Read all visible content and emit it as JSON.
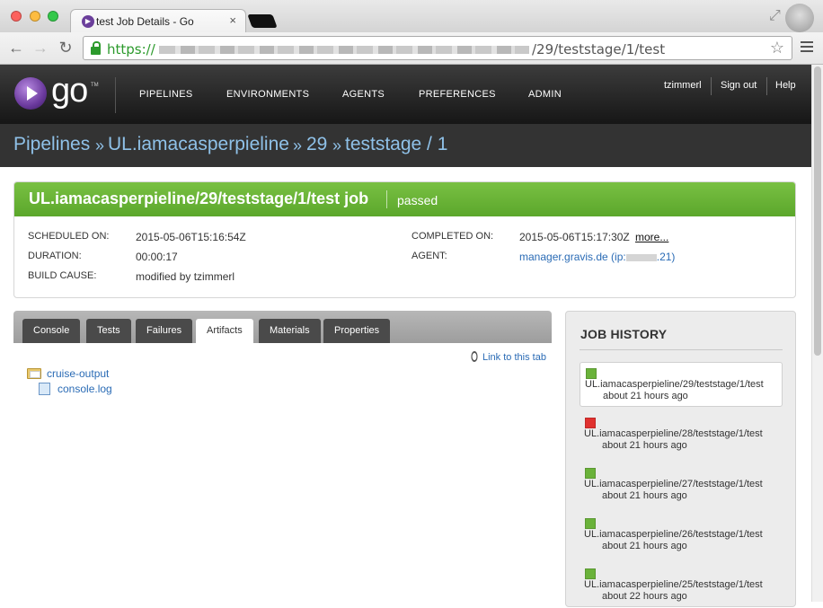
{
  "browser": {
    "tab_title": "test Job Details - Go",
    "tab_close": "×",
    "url_scheme": "https://",
    "url_path": "/29/teststage/1/test",
    "star": "☆",
    "nav_back": "←",
    "nav_forward": "→",
    "nav_reload": "↻",
    "fullscreen": "⤢"
  },
  "header": {
    "logo_text": "go",
    "logo_tm": "TM",
    "nav": [
      "PIPELINES",
      "ENVIRONMENTS",
      "AGENTS",
      "PREFERENCES",
      "ADMIN"
    ],
    "user": "tzimmerl",
    "sign_out": "Sign out",
    "help": "Help"
  },
  "breadcrumb": {
    "pipelines": "Pipelines",
    "sep": "»",
    "pipeline": "UL.iamacasperpieline",
    "counter": "29",
    "stage": "teststage / 1"
  },
  "job": {
    "title": "UL.iamacasperpieline/29/teststage/1/test job",
    "status": "passed",
    "status_color": "#6ab23a",
    "scheduled_label": "SCHEDULED ON:",
    "scheduled_value": "2015-05-06T15:16:54Z",
    "duration_label": "DURATION:",
    "duration_value": "00:00:17",
    "cause_label": "BUILD CAUSE:",
    "cause_value": "modified by tzimmerl",
    "completed_label": "COMPLETED ON:",
    "completed_value": "2015-05-06T15:17:30Z",
    "more": "more...",
    "agent_label": "AGENT:",
    "agent_prefix": "manager.gravis.de (ip:",
    "agent_suffix": ".21)"
  },
  "tabs": [
    "Console",
    "Tests",
    "Failures",
    "Artifacts",
    "Materials",
    "Properties"
  ],
  "active_tab": "Artifacts",
  "artifacts": {
    "link_to_tab": "Link to this tab",
    "folder": "cruise-output",
    "file": "console.log"
  },
  "history": {
    "title": "JOB HISTORY",
    "items": [
      {
        "name": "UL.iamacasperpieline/29/teststage/1/test",
        "time": "about 21 hours ago",
        "status": "passed"
      },
      {
        "name": "UL.iamacasperpieline/28/teststage/1/test",
        "time": "about 21 hours ago",
        "status": "failed"
      },
      {
        "name": "UL.iamacasperpieline/27/teststage/1/test",
        "time": "about 21 hours ago",
        "status": "passed"
      },
      {
        "name": "UL.iamacasperpieline/26/teststage/1/test",
        "time": "about 21 hours ago",
        "status": "passed"
      },
      {
        "name": "UL.iamacasperpieline/25/teststage/1/test",
        "time": "about 22 hours ago",
        "status": "passed"
      }
    ]
  },
  "colors": {
    "passed": "#6ab23a",
    "failed": "#e0312f",
    "link": "#2a6bb5",
    "breadcrumb": "#8fc1e8"
  }
}
